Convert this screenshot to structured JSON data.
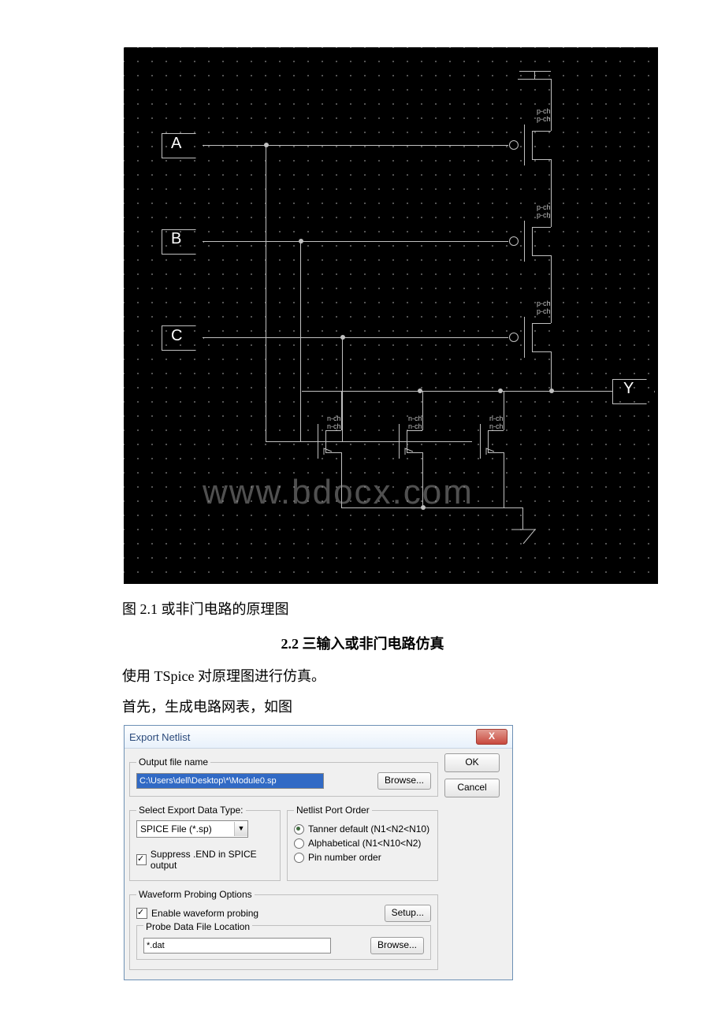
{
  "schematic": {
    "ports": {
      "A": "A",
      "B": "B",
      "C": "C",
      "Y": "Y"
    },
    "watermark": "www.bdocx.com"
  },
  "doc": {
    "caption_2_1": "图 2.1 或非门电路的原理图",
    "heading_2_2": "2.2 三输入或非门电路仿真",
    "para1": "使用 TSpice 对原理图进行仿真。",
    "para2": "首先，生成电路网表，如图"
  },
  "dialog": {
    "title": "Export Netlist",
    "ok": "OK",
    "cancel": "Cancel",
    "output_group": "Output file name",
    "output_path": "C:\\Users\\dell\\Desktop\\*\\Module0.sp",
    "browse": "Browse...",
    "select_group": "Select Export Data Type:",
    "combo_value": "SPICE File (*.sp)",
    "suppress_label": "Suppress .END in SPICE output",
    "port_group": "Netlist Port Order",
    "radio1": "Tanner default  (N1<N2<N10)",
    "radio2": "Alphabetical (N1<N10<N2)",
    "radio3": "Pin number order",
    "wave_group": "Waveform Probing Options",
    "enable_wave": "Enable waveform probing",
    "setup": "Setup...",
    "probe_group": "Probe Data File Location",
    "probe_path": "*.dat"
  }
}
